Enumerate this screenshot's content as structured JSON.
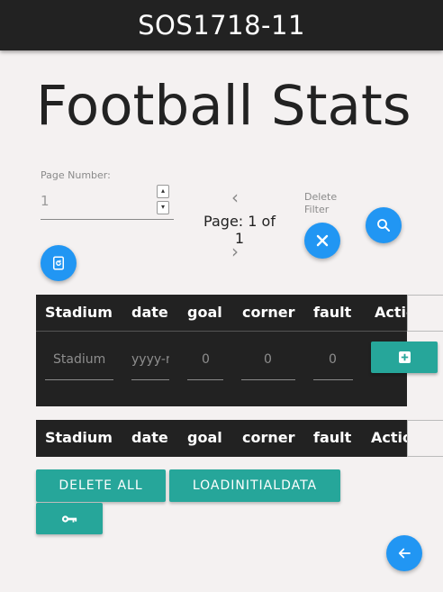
{
  "app": {
    "title": "SOS1718-11"
  },
  "page": {
    "title": "Football Stats"
  },
  "pagination": {
    "page_number_label": "Page Number:",
    "page_number_value": "1",
    "page_text_line1": "Page: 1 of",
    "page_text_line2": "1"
  },
  "filter": {
    "delete_filter_label_line1": "Delete",
    "delete_filter_label_line2": "Filter"
  },
  "table": {
    "columns": [
      "Stadium",
      "date",
      "goal",
      "corner",
      "fault",
      "Actions"
    ],
    "new_row": {
      "stadium_placeholder": "Stadium",
      "date_placeholder": "yyyy-mm-dd",
      "goal_value": "0",
      "corner_value": "0",
      "fault_value": "0"
    }
  },
  "results_table": {
    "columns": [
      "Stadium",
      "date",
      "goal",
      "corner",
      "fault",
      "Actions"
    ]
  },
  "buttons": {
    "delete_all": "DELETE ALL",
    "load_initial_data": "LOADINITIALDATA"
  },
  "icons": {
    "refresh": "refresh-icon",
    "search": "search-icon",
    "close": "close-icon",
    "add": "add-box-icon",
    "key": "key-icon",
    "back": "arrow-back-icon"
  },
  "colors": {
    "accent_blue": "#2196f3",
    "teal": "#26a69a",
    "dark": "#222222",
    "background": "#f4f1f1"
  }
}
